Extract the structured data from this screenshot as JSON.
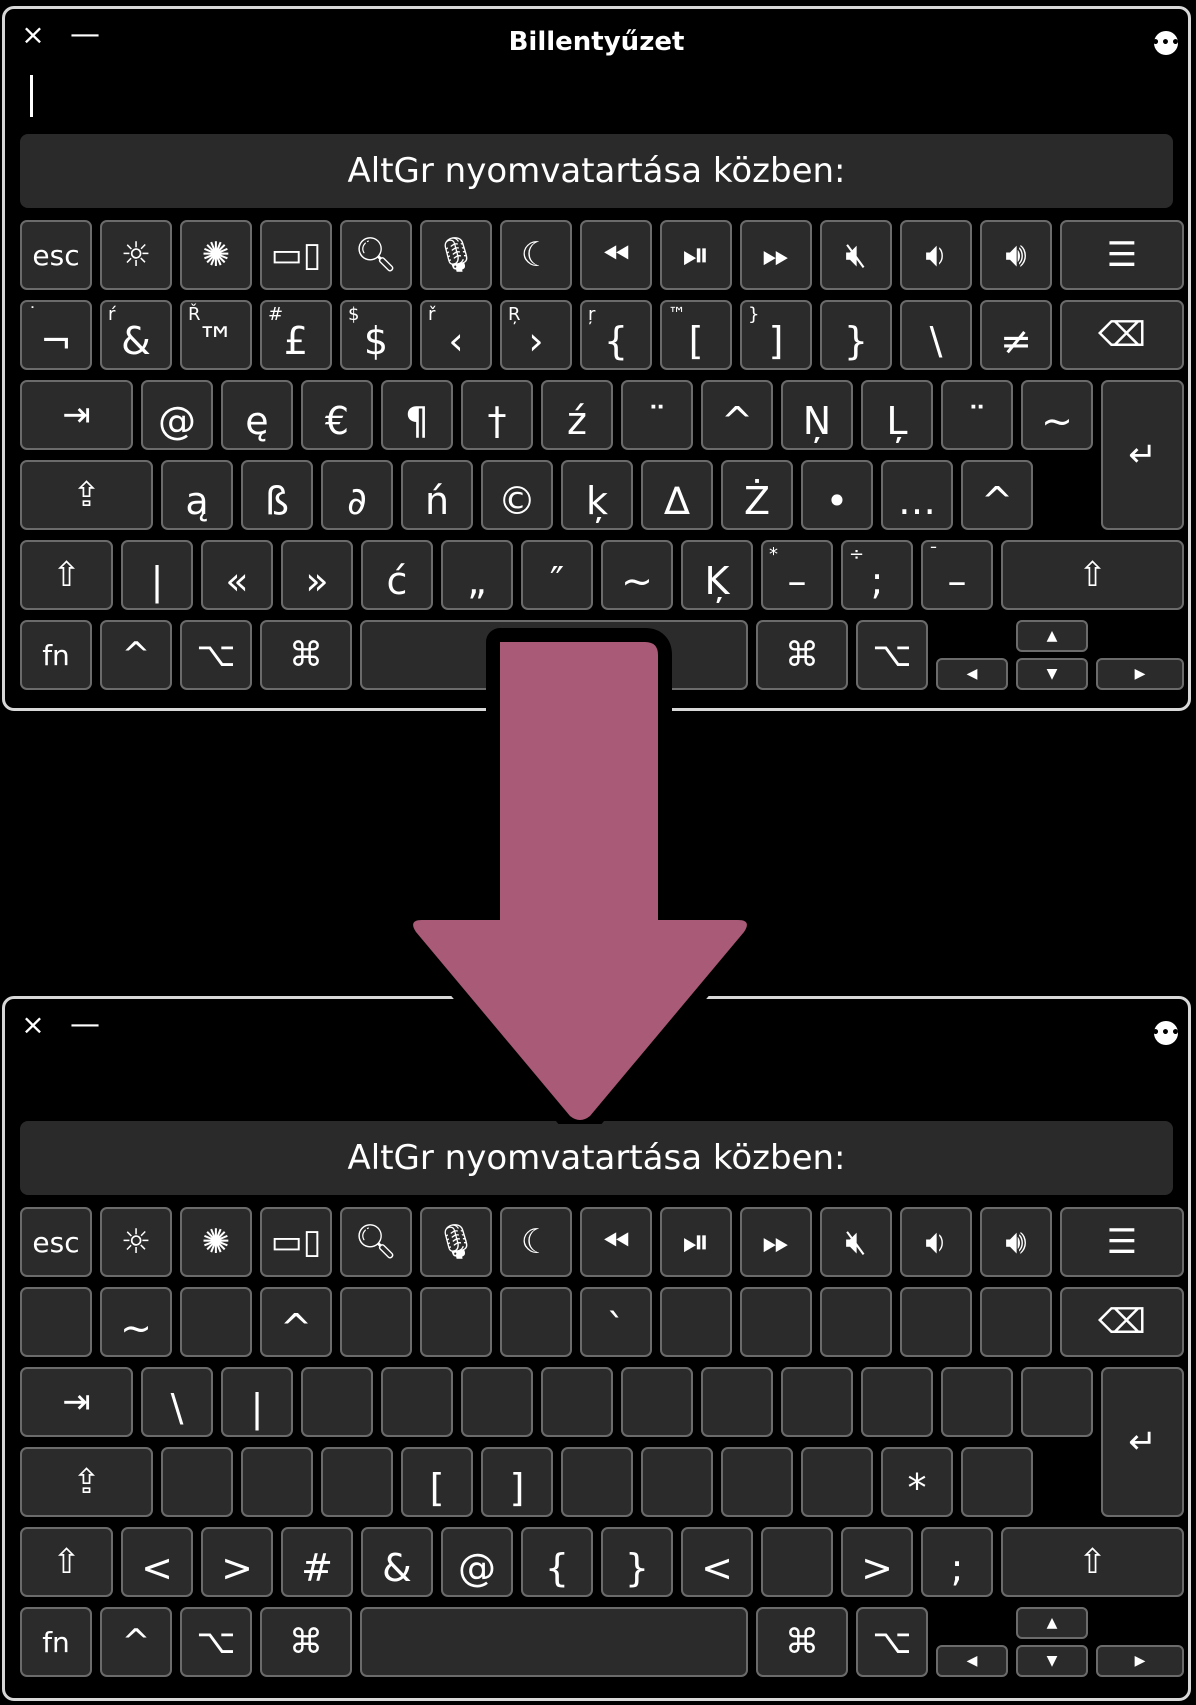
{
  "window_title": "Billentyűzet",
  "banner_text": "AltGr nyomvatartása közben:",
  "controls": {
    "close": "×",
    "minimize": "—",
    "more": "•••"
  },
  "colors": {
    "arrow": "#a95a76",
    "key_bg": "#2b2b2b",
    "key_border": "#6b6b6b"
  },
  "fn_row": [
    {
      "name": "esc-key",
      "label": "esc",
      "text": true
    },
    {
      "name": "brightness-down-icon",
      "label": "☼"
    },
    {
      "name": "brightness-up-icon",
      "label": "✺"
    },
    {
      "name": "mission-control-icon",
      "label": "▭▯"
    },
    {
      "name": "search-icon",
      "label": "🔍︎"
    },
    {
      "name": "microphone-icon",
      "label": "🎙︎"
    },
    {
      "name": "moon-icon",
      "label": "☾"
    },
    {
      "name": "rewind-icon",
      "label": "⏪︎"
    },
    {
      "name": "play-pause-icon",
      "label": "⏯︎"
    },
    {
      "name": "fast-forward-icon",
      "label": "⏩︎"
    },
    {
      "name": "mute-icon",
      "label": "🔇︎"
    },
    {
      "name": "volume-down-icon",
      "label": "🔉︎"
    },
    {
      "name": "volume-up-icon",
      "label": "🔊︎"
    },
    {
      "name": "list-icon",
      "label": "☰"
    }
  ],
  "top": {
    "row1": [
      {
        "sec": "˙",
        "main": "¬"
      },
      {
        "sec": "ŕ",
        "main": "&"
      },
      {
        "sec": "Ř",
        "main": "™"
      },
      {
        "sec": "#",
        "main": "£"
      },
      {
        "sec": "$",
        "main": "$"
      },
      {
        "sec": "ř",
        "main": "‹"
      },
      {
        "sec": "Ŗ",
        "main": "›"
      },
      {
        "sec": "ŗ",
        "main": "{"
      },
      {
        "sec": "™",
        "main": "["
      },
      {
        "sec": "}",
        "main": "]"
      },
      {
        "sec": "",
        "main": "}"
      },
      {
        "sec": "",
        "main": "\\"
      },
      {
        "sec": "",
        "main": "≠"
      }
    ],
    "row2": [
      {
        "main": "@"
      },
      {
        "main": "ę"
      },
      {
        "main": "€"
      },
      {
        "main": "¶"
      },
      {
        "main": "†"
      },
      {
        "main": "ź"
      },
      {
        "main": "¨"
      },
      {
        "main": "^"
      },
      {
        "main": "Ņ"
      },
      {
        "main": "Ļ"
      },
      {
        "main": "¨"
      },
      {
        "main": "~"
      }
    ],
    "row3": [
      {
        "main": "ą"
      },
      {
        "main": "ß"
      },
      {
        "main": "∂"
      },
      {
        "main": "ń"
      },
      {
        "main": "©"
      },
      {
        "main": "ķ"
      },
      {
        "main": "∆"
      },
      {
        "main": "Ż"
      },
      {
        "main": "•"
      },
      {
        "main": "…"
      },
      {
        "main": "^"
      },
      {
        "main": "`"
      }
    ],
    "row4": [
      {
        "sec": "",
        "main": "|"
      },
      {
        "sec": "",
        "main": "«"
      },
      {
        "sec": "",
        "main": "»"
      },
      {
        "sec": "",
        "main": "ć"
      },
      {
        "sec": "",
        "main": "„"
      },
      {
        "sec": "",
        "main": "″"
      },
      {
        "sec": "",
        "main": "~"
      },
      {
        "sec": "",
        "main": "Ķ"
      },
      {
        "sec": "*",
        "main": "–"
      },
      {
        "sec": "÷",
        "main": ";"
      },
      {
        "sec": "¯",
        "main": "–"
      }
    ]
  },
  "bottom": {
    "row1": [
      "",
      "~",
      "",
      "^",
      "",
      "",
      "",
      "`",
      "",
      "",
      "",
      "",
      ""
    ],
    "row2": [
      "\\",
      "|",
      "",
      "",
      "",
      "",
      "",
      "",
      "",
      "",
      "",
      ""
    ],
    "row3": [
      "",
      "",
      "",
      "[",
      "]",
      "",
      "",
      "",
      "",
      "*",
      ""
    ],
    "row4": [
      "<",
      ">",
      "#",
      "&",
      "@",
      "{",
      "}",
      "<",
      "",
      ">",
      ";"
    ]
  },
  "mods": {
    "tab": "⇥",
    "caps": "⇪",
    "shift": "⇧",
    "return": "↵",
    "delete": "⌫",
    "fn": "fn",
    "ctrl": "^",
    "option": "⌥",
    "cmd": "⌘",
    "up": "▲",
    "down": "▼",
    "left": "◀",
    "right": "▶"
  }
}
